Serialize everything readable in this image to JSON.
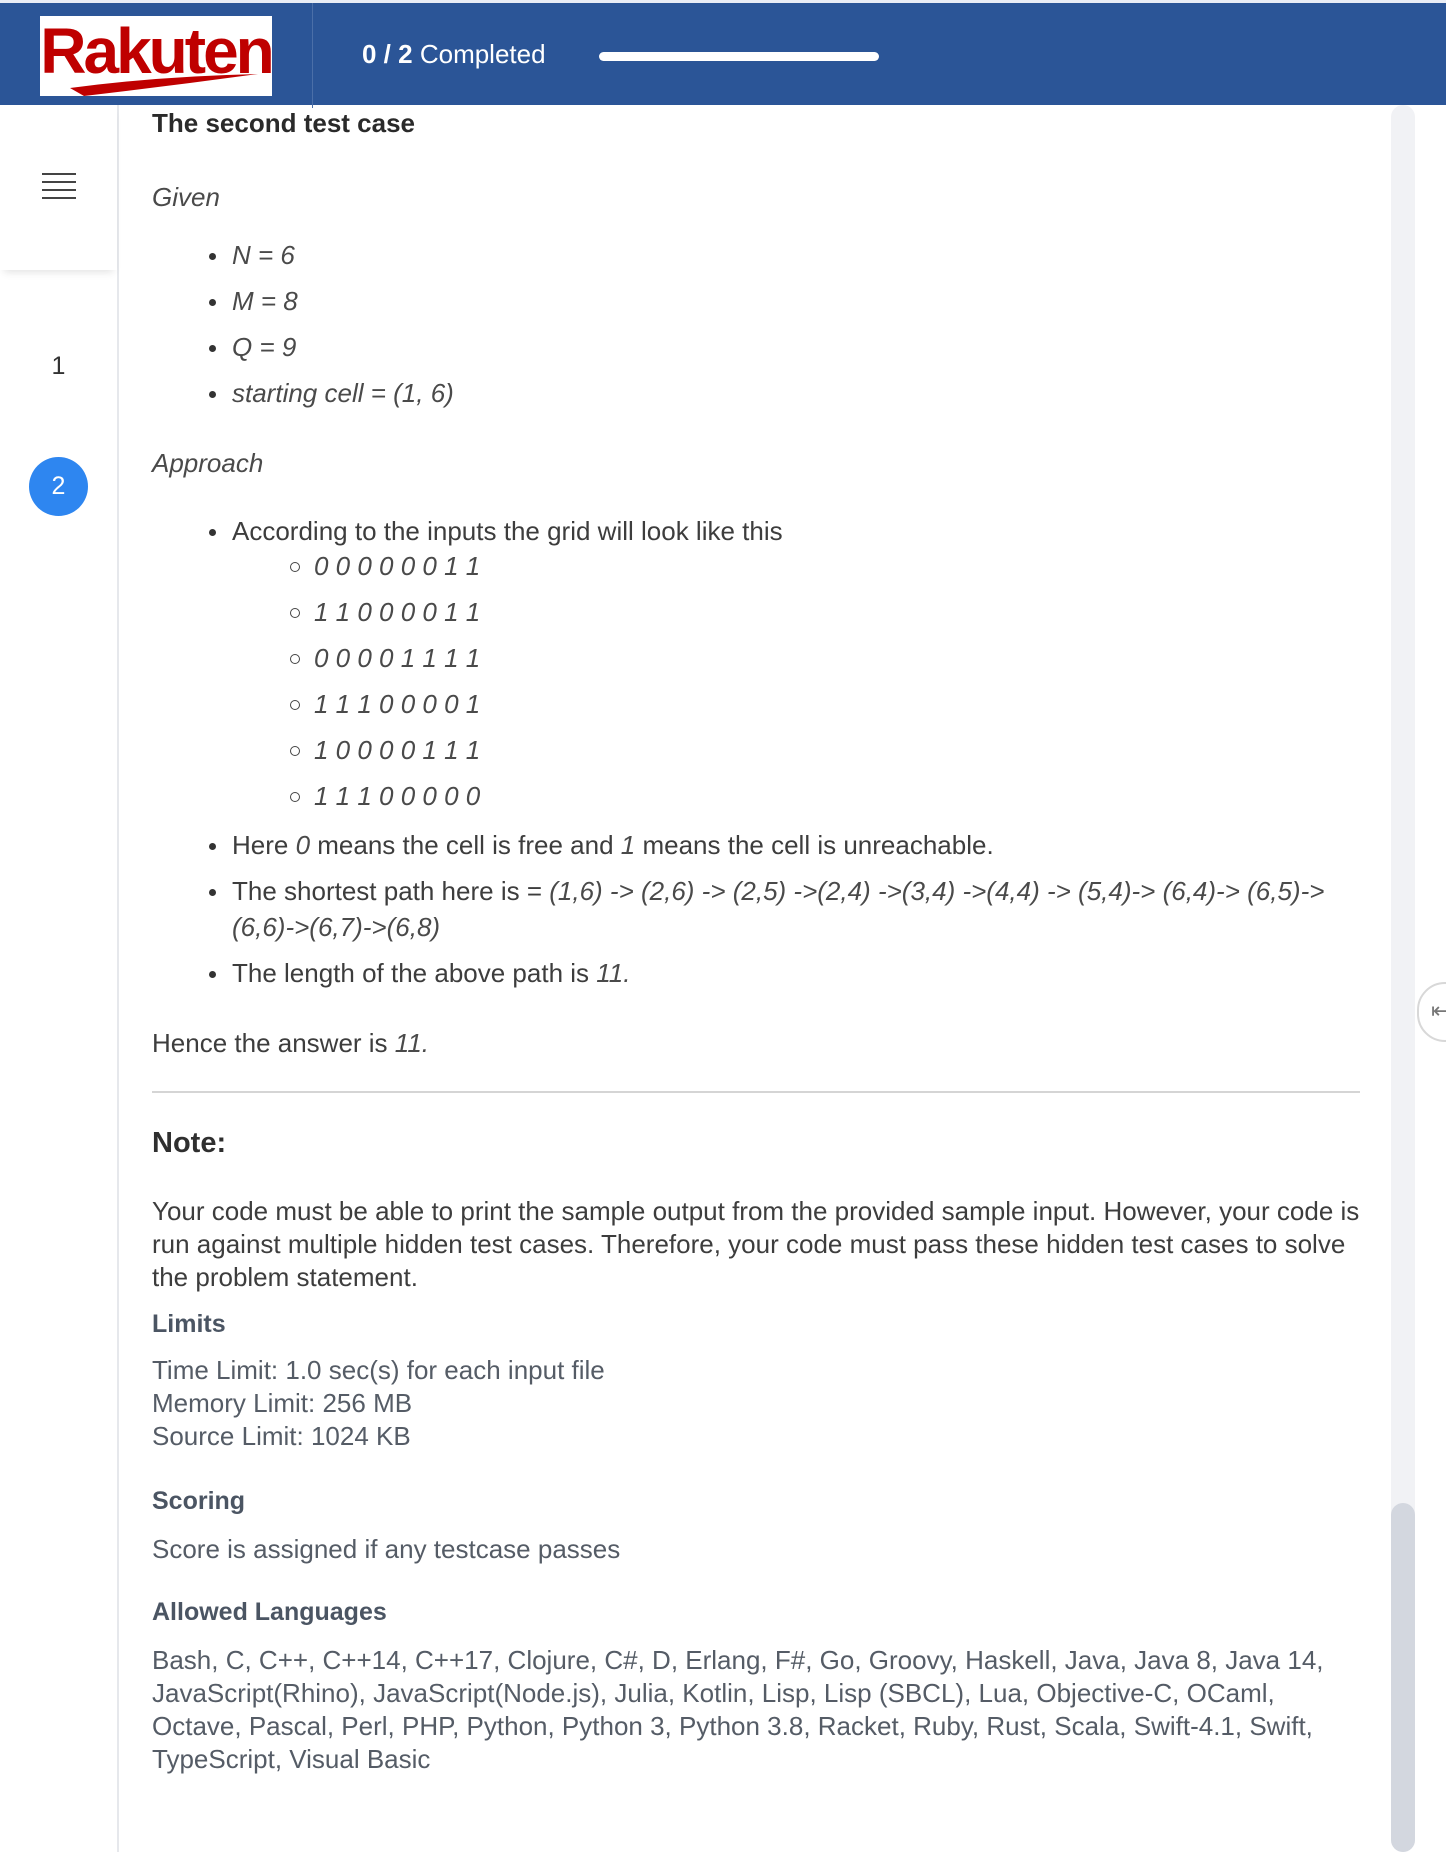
{
  "header": {
    "logo_text": "Rakuten",
    "progress_count": "0 / 2",
    "progress_suffix": "Completed",
    "progress_fraction": 0.0
  },
  "sidebar": {
    "questions": [
      {
        "label": "1",
        "active": false
      },
      {
        "label": "2",
        "active": true
      }
    ]
  },
  "content": {
    "title": "The second test case",
    "given_label": "Given",
    "given": [
      "N = 6",
      "M = 8",
      "Q = 9",
      "starting cell = (1, 6)"
    ],
    "approach_label": "Approach",
    "grid_intro": "According to the inputs the grid will look like this",
    "grid_rows": [
      "0 0 0 0 0 0 1 1",
      "1 1 0 0 0 0 1 1",
      "0 0 0 0 1 1 1 1",
      "1 1 1 0 0 0 0 1",
      "1 0 0 0 0 1 1 1",
      "1 1 1 0 0 0 0 0"
    ],
    "here_pre": "Here ",
    "here_zero": "0",
    "here_mid": " means the cell is free and ",
    "here_one": "1",
    "here_post": " means the cell is unreachable.",
    "path_pre": "The shortest path here is = ",
    "path_value": "(1,6) -> (2,6) -> (2,5) ->(2,4) ->(3,4) ->(4,4) -> (5,4)-> (6,4)-> (6,5)-> (6,6)->(6,7)->(6,8)",
    "length_pre": "The length of the above path is ",
    "length_value": "11.",
    "answer_pre": "Hence the answer is ",
    "answer_value": "11.",
    "note_title": "Note:",
    "note_text": "Your code must be able to print the sample output from the provided sample input. However, your code is run against multiple hidden test cases. Therefore, your code must pass these hidden test cases to solve the problem statement.",
    "limits_title": "Limits",
    "limits": [
      "Time Limit: 1.0 sec(s) for each input file",
      "Memory Limit: 256 MB",
      "Source Limit: 1024 KB"
    ],
    "scoring_title": "Scoring",
    "scoring_text": "Score is assigned if any testcase passes",
    "languages_title": "Allowed Languages",
    "languages_text": "Bash, C, C++, C++14, C++17, Clojure, C#, D, Erlang, F#, Go, Groovy, Haskell, Java, Java 8, Java 14, JavaScript(Rhino), JavaScript(Node.js), Julia, Kotlin, Lisp, Lisp (SBCL), Lua, Objective-C, OCaml, Octave, Pascal, Perl, PHP, Python, Python 3, Python 3.8, Racket, Ruby, Rust, Scala, Swift-4.1, Swift, TypeScript, Visual Basic"
  },
  "icons": {
    "menu": "hamburger-menu-icon",
    "collapse": "collapse-panel-icon"
  },
  "colors": {
    "header_bg": "#2b5597",
    "brand_red": "#bf0000",
    "active_question": "#2e86f0"
  }
}
